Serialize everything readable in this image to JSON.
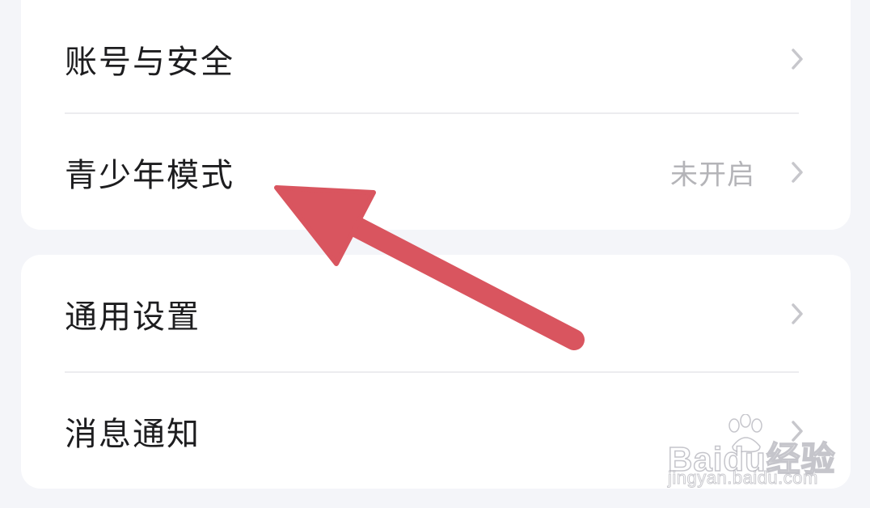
{
  "settings": {
    "group1": {
      "items": [
        {
          "label": "账号与安全",
          "value": ""
        },
        {
          "label": "青少年模式",
          "value": "未开启"
        }
      ]
    },
    "group2": {
      "items": [
        {
          "label": "通用设置",
          "value": ""
        },
        {
          "label": "消息通知",
          "value": ""
        }
      ]
    }
  },
  "annotation": {
    "arrow_color": "#d9555f"
  },
  "watermark": {
    "brand": "Baidu经验",
    "url": "jingyan.baidu.com"
  },
  "colors": {
    "background": "#f4f5f9",
    "card": "#ffffff",
    "label": "#1d1d1f",
    "value": "#b4b4b8",
    "chevron": "#c7c7cc",
    "divider": "#ececef"
  }
}
